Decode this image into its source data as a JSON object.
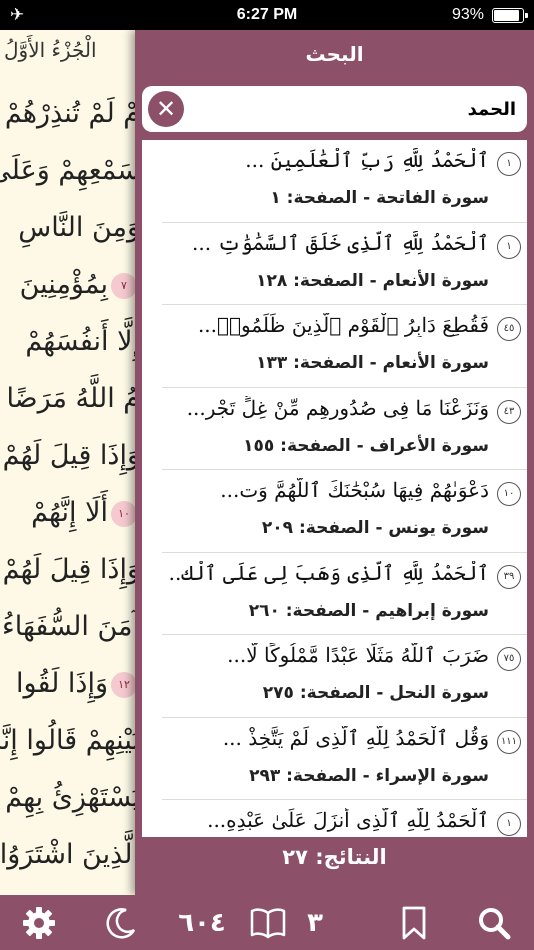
{
  "status_bar": {
    "time": "6:27 PM",
    "battery_percent": "93%",
    "battery_level": 0.93,
    "airplane_icon": "airplane-icon"
  },
  "quran_page": {
    "juz_label": "الْجُزْءُ الأَوَّلُ",
    "lines": [
      {
        "text": "مْ لَمْ تُنذِرْهُمْ",
        "marker": ""
      },
      {
        "text": "سَمْعِهِمْ وَعَلَىٰ",
        "marker": ""
      },
      {
        "text": "وَمِنَ النَّاسِ",
        "marker": ""
      },
      {
        "text": "بِمُؤْمِنِينَ",
        "marker": "٧"
      },
      {
        "text": "إِلَّا أَنفُسَهُمْ",
        "marker": ""
      },
      {
        "text": "مُ اللَّهُ مَرَضًا",
        "marker": ""
      },
      {
        "text": "وَإِذَا قِيلَ لَهُمْ",
        "marker": ""
      },
      {
        "text": "أَلَا إِنَّهُمْ",
        "marker": "١٠"
      },
      {
        "text": "وَإِذَا قِيلَ لَهُمْ",
        "marker": ""
      },
      {
        "text": "آمَنَ السُّفَهَاءُ",
        "marker": ""
      },
      {
        "text": "وَإِذَا لَقُوا",
        "marker": "١٢"
      },
      {
        "text": "بَيْنِهِمْ قَالُوا إِنَّا",
        "marker": ""
      },
      {
        "text": "يَسْتَهْزِئُ بِهِمْ",
        "marker": ""
      },
      {
        "text": "الَّذِينَ اشْتَرَوُا",
        "marker": ""
      }
    ]
  },
  "search_panel": {
    "title": "البحث",
    "query": "الحمد",
    "clear_icon": "close-icon",
    "results": [
      {
        "number": "١",
        "text": "ٱلْحَمْدُ لِلَّهِ رَبِّ ٱلْعَٰلَمِينَ ...",
        "meta": "سورة الفاتحة - الصفحة: ١"
      },
      {
        "number": "١",
        "text": "ٱلْحَمْدُ لِلَّهِ ٱلَّذِى خَلَقَ ٱلسَّمَٰوَٰتِ ...",
        "meta": "سورة الأنعام - الصفحة: ١٢٨"
      },
      {
        "number": "٤٥",
        "text": "فَقُطِعَ دَابِرُ ٱلْقَوْمِ ٱلَّذِينَ ظَلَمُوا۟...",
        "meta": "سورة الأنعام - الصفحة: ١٣٣"
      },
      {
        "number": "٤٣",
        "text": "وَنَزَعْنَا مَا فِى صُدُورِهِم مِّنْ غِلٍّ تَجْرِ...",
        "meta": "سورة الأعراف - الصفحة: ١٥٥"
      },
      {
        "number": "١٠",
        "text": "دَعْوَىٰهُمْ فِيهَا سُبْحَٰنَكَ ٱللَّهُمَّ وَت...",
        "meta": "سورة يونس - الصفحة: ٢٠٩"
      },
      {
        "number": "٣٩",
        "text": "ٱلْحَمْدُ لِلَّهِ ٱلَّذِى وَهَبَ لِى عَلَى ٱلْك...",
        "meta": "سورة إبراهيم - الصفحة: ٢٦٠"
      },
      {
        "number": "٧٥",
        "text": "ضَرَبَ ٱللَّهُ مَثَلًا عَبْدًا مَّمْلُوكًا لَّا...",
        "meta": "سورة النحل - الصفحة: ٢٧٥"
      },
      {
        "number": "١١١",
        "text": "وَقُلِ ٱلْحَمْدُ لِلَّهِ ٱلَّذِى لَمْ يَتَّخِذْ ...",
        "meta": "سورة الإسراء - الصفحة: ٢٩٣"
      },
      {
        "number": "١",
        "text": "ٱلْحَمْدُ لِلَّهِ ٱلَّذِى أَنزَلَ عَلَىٰ عَبْدِهِ...",
        "meta": ""
      }
    ],
    "results_count": "النتائج: ٢٧"
  },
  "toolbar": {
    "settings_icon": "gear-icon",
    "night_icon": "moon-icon",
    "page_number": "٦٠٤",
    "book_icon": "book-icon",
    "juz_number": "٣",
    "bookmark_icon": "bookmark-icon",
    "search_icon": "search-icon"
  },
  "colors": {
    "accent": "#8c5068",
    "page_bg": "#fdf9e6",
    "ayah_marker": "#f4c9cf"
  }
}
